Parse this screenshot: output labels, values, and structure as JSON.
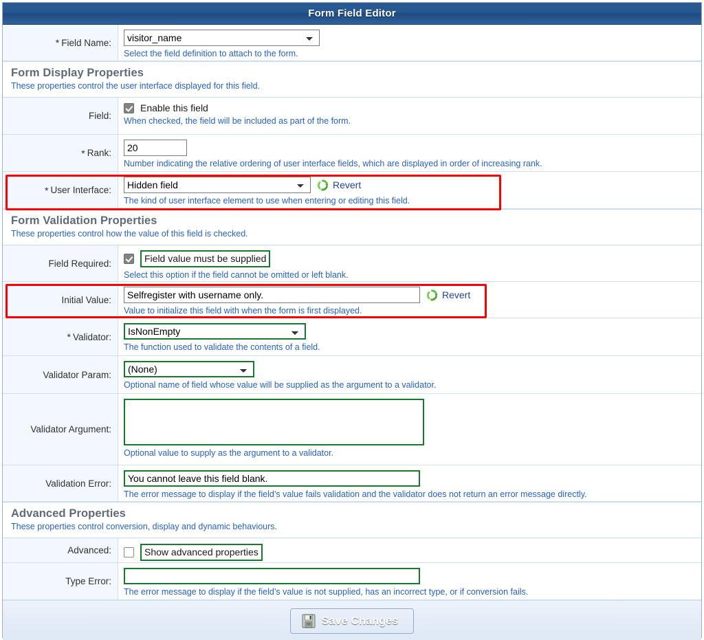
{
  "window": {
    "title": "Form Field Editor"
  },
  "colors": {
    "titlebar": "#27578f",
    "hint_text": "#2763c4",
    "section_title": "#5f6b78",
    "highlight_red": "#ff0000",
    "highlight_green": "#157a2b",
    "save_button": "#2f5c94"
  },
  "fields": {
    "field_name": {
      "label": "Field Name:",
      "required_marker": "*",
      "value": "visitor_name",
      "hint": "Select the field definition to attach to the form.",
      "control": "select"
    }
  },
  "sections": [
    {
      "id": "display",
      "title": "Form Display Properties",
      "description": "These properties control the user interface displayed for this field."
    },
    {
      "id": "validation",
      "title": "Form Validation Properties",
      "description": "These properties control how the value of this field is checked."
    },
    {
      "id": "advanced",
      "title": "Advanced Properties",
      "description": "These properties control conversion, display and dynamic behaviours."
    }
  ],
  "display_rows": {
    "field_enable": {
      "label": "Field:",
      "required_marker": "",
      "checkbox_checked": true,
      "checkbox_label": "Enable this field",
      "hint": "When checked, the field will be included as part of the form."
    },
    "rank": {
      "label": "Rank:",
      "required_marker": "*",
      "value": "20",
      "hint": "Number indicating the relative ordering of user interface fields, which are displayed in order of increasing rank."
    },
    "user_interface": {
      "label": "User Interface:",
      "required_marker": "*",
      "value": "Hidden field",
      "revert_label": "Revert",
      "hint": "The kind of user interface element to use when entering or editing this field.",
      "highlighted": "red"
    }
  },
  "validation_rows": {
    "field_required": {
      "label": "Field Required:",
      "required_marker": "",
      "checkbox_checked": true,
      "checkbox_label": "Field value must be supplied",
      "hint": "Select this option if the field cannot be omitted or left blank.",
      "highlighted": "green"
    },
    "initial_value": {
      "label": "Initial Value:",
      "required_marker": "",
      "value": "Selfregister with username only.",
      "revert_label": "Revert",
      "hint": "Value to initialize this field with when the form is first displayed.",
      "highlighted": "red"
    },
    "validator": {
      "label": "Validator:",
      "required_marker": "*",
      "value": "IsNonEmpty",
      "hint": "The function used to validate the contents of a field.",
      "highlighted": "green"
    },
    "validator_param": {
      "label": "Validator Param:",
      "required_marker": "",
      "value": "(None)",
      "hint": "Optional name of field whose value will be supplied as the argument to a validator.",
      "highlighted": "green"
    },
    "validator_argument": {
      "label": "Validator Argument:",
      "required_marker": "",
      "value": "",
      "hint": "Optional value to supply as the argument to a validator.",
      "highlighted": "green"
    },
    "validation_error": {
      "label": "Validation Error:",
      "required_marker": "",
      "value": "You cannot leave this field blank.",
      "hint": "The error message to display if the field’s value fails validation and the validator does not return an error message directly.",
      "highlighted": "green"
    }
  },
  "advanced_rows": {
    "advanced": {
      "label": "Advanced:",
      "required_marker": "",
      "checkbox_checked": false,
      "checkbox_label": "Show advanced properties",
      "hint": "",
      "highlighted": "green"
    },
    "type_error": {
      "label": "Type Error:",
      "required_marker": "",
      "value": "",
      "hint": "The error message to display if the field’s value is not supplied, has an incorrect type, or if conversion fails.",
      "highlighted": "green"
    }
  },
  "footer": {
    "save_label": "Save Changes",
    "save_icon": "floppy-disk-icon"
  },
  "icons": {
    "revert": "recycle-arrows-icon",
    "dropdown": "chevron-down-icon",
    "checkbox_checked": "checkmark-icon"
  }
}
